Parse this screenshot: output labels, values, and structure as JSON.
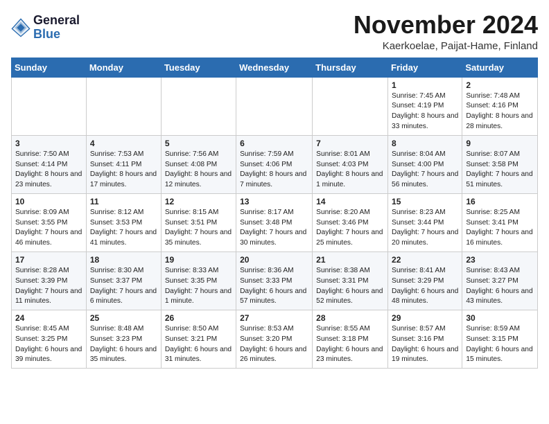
{
  "logo": {
    "general": "General",
    "blue": "Blue"
  },
  "title": "November 2024",
  "subtitle": "Kaerkoelae, Paijat-Hame, Finland",
  "days_of_week": [
    "Sunday",
    "Monday",
    "Tuesday",
    "Wednesday",
    "Thursday",
    "Friday",
    "Saturday"
  ],
  "weeks": [
    [
      {
        "day": "",
        "info": ""
      },
      {
        "day": "",
        "info": ""
      },
      {
        "day": "",
        "info": ""
      },
      {
        "day": "",
        "info": ""
      },
      {
        "day": "",
        "info": ""
      },
      {
        "day": "1",
        "info": "Sunrise: 7:45 AM\nSunset: 4:19 PM\nDaylight: 8 hours and 33 minutes."
      },
      {
        "day": "2",
        "info": "Sunrise: 7:48 AM\nSunset: 4:16 PM\nDaylight: 8 hours and 28 minutes."
      }
    ],
    [
      {
        "day": "3",
        "info": "Sunrise: 7:50 AM\nSunset: 4:14 PM\nDaylight: 8 hours and 23 minutes."
      },
      {
        "day": "4",
        "info": "Sunrise: 7:53 AM\nSunset: 4:11 PM\nDaylight: 8 hours and 17 minutes."
      },
      {
        "day": "5",
        "info": "Sunrise: 7:56 AM\nSunset: 4:08 PM\nDaylight: 8 hours and 12 minutes."
      },
      {
        "day": "6",
        "info": "Sunrise: 7:59 AM\nSunset: 4:06 PM\nDaylight: 8 hours and 7 minutes."
      },
      {
        "day": "7",
        "info": "Sunrise: 8:01 AM\nSunset: 4:03 PM\nDaylight: 8 hours and 1 minute."
      },
      {
        "day": "8",
        "info": "Sunrise: 8:04 AM\nSunset: 4:00 PM\nDaylight: 7 hours and 56 minutes."
      },
      {
        "day": "9",
        "info": "Sunrise: 8:07 AM\nSunset: 3:58 PM\nDaylight: 7 hours and 51 minutes."
      }
    ],
    [
      {
        "day": "10",
        "info": "Sunrise: 8:09 AM\nSunset: 3:55 PM\nDaylight: 7 hours and 46 minutes."
      },
      {
        "day": "11",
        "info": "Sunrise: 8:12 AM\nSunset: 3:53 PM\nDaylight: 7 hours and 41 minutes."
      },
      {
        "day": "12",
        "info": "Sunrise: 8:15 AM\nSunset: 3:51 PM\nDaylight: 7 hours and 35 minutes."
      },
      {
        "day": "13",
        "info": "Sunrise: 8:17 AM\nSunset: 3:48 PM\nDaylight: 7 hours and 30 minutes."
      },
      {
        "day": "14",
        "info": "Sunrise: 8:20 AM\nSunset: 3:46 PM\nDaylight: 7 hours and 25 minutes."
      },
      {
        "day": "15",
        "info": "Sunrise: 8:23 AM\nSunset: 3:44 PM\nDaylight: 7 hours and 20 minutes."
      },
      {
        "day": "16",
        "info": "Sunrise: 8:25 AM\nSunset: 3:41 PM\nDaylight: 7 hours and 16 minutes."
      }
    ],
    [
      {
        "day": "17",
        "info": "Sunrise: 8:28 AM\nSunset: 3:39 PM\nDaylight: 7 hours and 11 minutes."
      },
      {
        "day": "18",
        "info": "Sunrise: 8:30 AM\nSunset: 3:37 PM\nDaylight: 7 hours and 6 minutes."
      },
      {
        "day": "19",
        "info": "Sunrise: 8:33 AM\nSunset: 3:35 PM\nDaylight: 7 hours and 1 minute."
      },
      {
        "day": "20",
        "info": "Sunrise: 8:36 AM\nSunset: 3:33 PM\nDaylight: 6 hours and 57 minutes."
      },
      {
        "day": "21",
        "info": "Sunrise: 8:38 AM\nSunset: 3:31 PM\nDaylight: 6 hours and 52 minutes."
      },
      {
        "day": "22",
        "info": "Sunrise: 8:41 AM\nSunset: 3:29 PM\nDaylight: 6 hours and 48 minutes."
      },
      {
        "day": "23",
        "info": "Sunrise: 8:43 AM\nSunset: 3:27 PM\nDaylight: 6 hours and 43 minutes."
      }
    ],
    [
      {
        "day": "24",
        "info": "Sunrise: 8:45 AM\nSunset: 3:25 PM\nDaylight: 6 hours and 39 minutes."
      },
      {
        "day": "25",
        "info": "Sunrise: 8:48 AM\nSunset: 3:23 PM\nDaylight: 6 hours and 35 minutes."
      },
      {
        "day": "26",
        "info": "Sunrise: 8:50 AM\nSunset: 3:21 PM\nDaylight: 6 hours and 31 minutes."
      },
      {
        "day": "27",
        "info": "Sunrise: 8:53 AM\nSunset: 3:20 PM\nDaylight: 6 hours and 26 minutes."
      },
      {
        "day": "28",
        "info": "Sunrise: 8:55 AM\nSunset: 3:18 PM\nDaylight: 6 hours and 23 minutes."
      },
      {
        "day": "29",
        "info": "Sunrise: 8:57 AM\nSunset: 3:16 PM\nDaylight: 6 hours and 19 minutes."
      },
      {
        "day": "30",
        "info": "Sunrise: 8:59 AM\nSunset: 3:15 PM\nDaylight: 6 hours and 15 minutes."
      }
    ]
  ]
}
